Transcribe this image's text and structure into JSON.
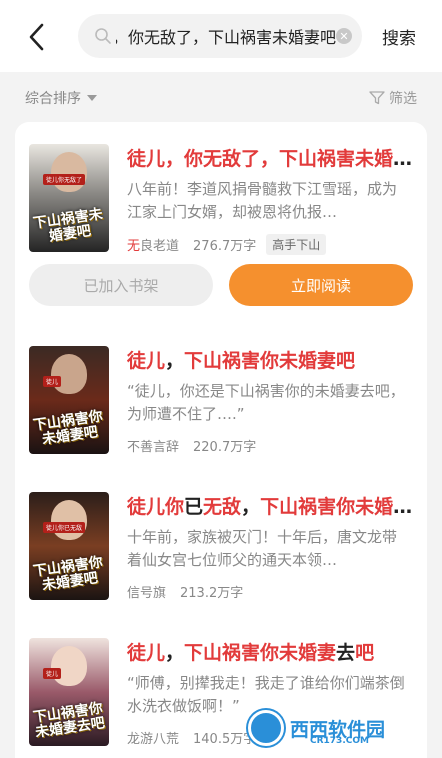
{
  "header": {
    "query": "徒儿，你无敌了，下山祸害未婚妻吧",
    "search_label": "搜索",
    "clear_glyph": "✕"
  },
  "filters": {
    "sort_label": "综合排序",
    "filter_label": "筛选"
  },
  "books": [
    {
      "title_parts": [
        "徒儿，你无敌了，下山祸害未婚妻吧",
        ""
      ],
      "description": "八年前！李道风捐骨髓救下江雪瑶，成为江家上门女婿，却被恩将仇报…",
      "author_first": "无",
      "author_rest": "良老道",
      "word_count": "276.7万字",
      "tag": "高手下山",
      "cover_title": "下山祸害未婚妻吧",
      "cover_tag": "徒儿你无敌了"
    },
    {
      "title_parts": [
        "徒儿",
        "，",
        "下山祸害你未婚妻吧"
      ],
      "description": "“徒儿，你还是下山祸害你的未婚妻去吧，为师遭不住了….”",
      "author": "不善言辞",
      "word_count": "220.7万字",
      "cover_title": "下山祸害你未婚妻吧",
      "cover_tag": "徒儿"
    },
    {
      "title_parts": [
        "徒儿你",
        "已",
        "无敌",
        "，",
        "下山祸害你未婚妻吧"
      ],
      "description": "十年前，家族被灭门！十年后，唐文龙带着仙女宫七位师父的通天本领…",
      "author": "信号旗",
      "word_count": "213.2万字",
      "cover_title": "下山祸害你未婚妻吧",
      "cover_tag": "徒儿你已无敌"
    },
    {
      "title_parts": [
        "徒儿",
        "，",
        "下山祸害你未婚妻",
        "去",
        "吧"
      ],
      "description": "“师傅，别撵我走！我走了谁给你们端茶倒水洗衣做饭啊！”",
      "author": "龙游八荒",
      "word_count": "140.5万字",
      "cover_title": "下山祸害你未婚妻去吧",
      "cover_tag": "徒儿"
    }
  ],
  "actions": {
    "shelf_label": "已加入书架",
    "read_label": "立即阅读"
  },
  "watermark": {
    "text": "西西软件园",
    "sub": "CR173.COM"
  },
  "colors": {
    "highlight": "#e23b3b",
    "accent": "#f5902e",
    "background": "#f3f3f3"
  }
}
